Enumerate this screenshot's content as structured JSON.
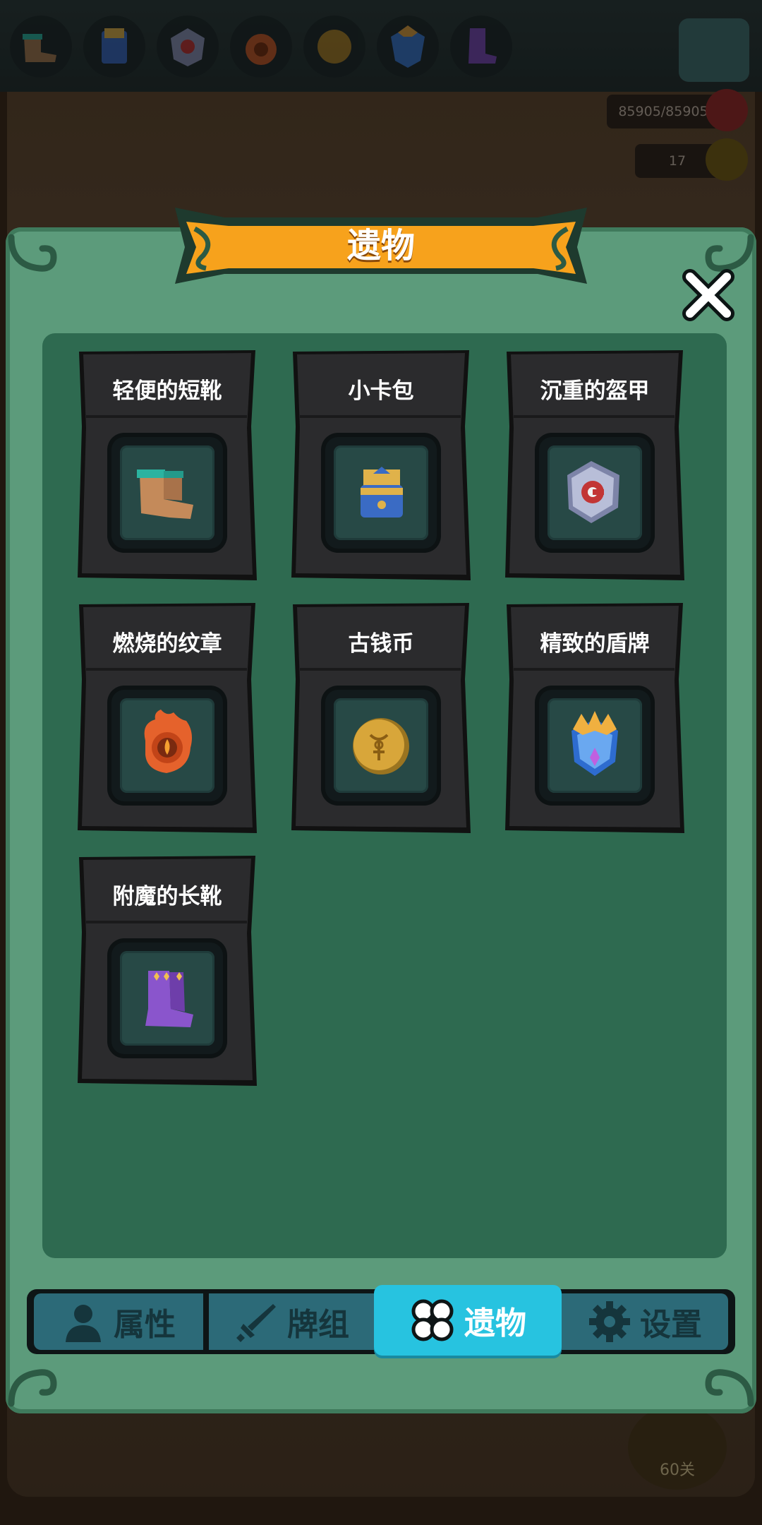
{
  "background": {
    "hp_text": "85905/85905",
    "coin_text": "17",
    "level_text": "60关",
    "top_relics": [
      "boots-icon",
      "card-pack-icon",
      "armor-icon",
      "emblem-icon",
      "coin-icon",
      "shield-icon",
      "long-boots-icon"
    ]
  },
  "modal": {
    "title": "遗物",
    "relics": [
      {
        "name": "轻便的短靴",
        "icon": "light-boots-icon"
      },
      {
        "name": "小卡包",
        "icon": "card-pack-icon"
      },
      {
        "name": "沉重的盔甲",
        "icon": "heavy-armor-icon"
      },
      {
        "name": "燃烧的纹章",
        "icon": "burning-emblem-icon"
      },
      {
        "name": "古钱币",
        "icon": "ancient-coin-icon"
      },
      {
        "name": "精致的盾牌",
        "icon": "exquisite-shield-icon"
      },
      {
        "name": "附魔的长靴",
        "icon": "enchanted-boots-icon"
      }
    ]
  },
  "tabs": [
    {
      "label": "属性",
      "icon": "person-icon",
      "active": false
    },
    {
      "label": "牌组",
      "icon": "sword-icon",
      "active": false
    },
    {
      "label": "遗物",
      "icon": "clover-icon",
      "active": true
    },
    {
      "label": "设置",
      "icon": "gear-icon",
      "active": false
    }
  ],
  "colors": {
    "banner": "#f7a21c",
    "modal": "#5c9b7b",
    "panel": "#2e6a50",
    "card": "#2a2a2a",
    "tab": "#2c6a78",
    "tab_active": "#27c3e0"
  }
}
